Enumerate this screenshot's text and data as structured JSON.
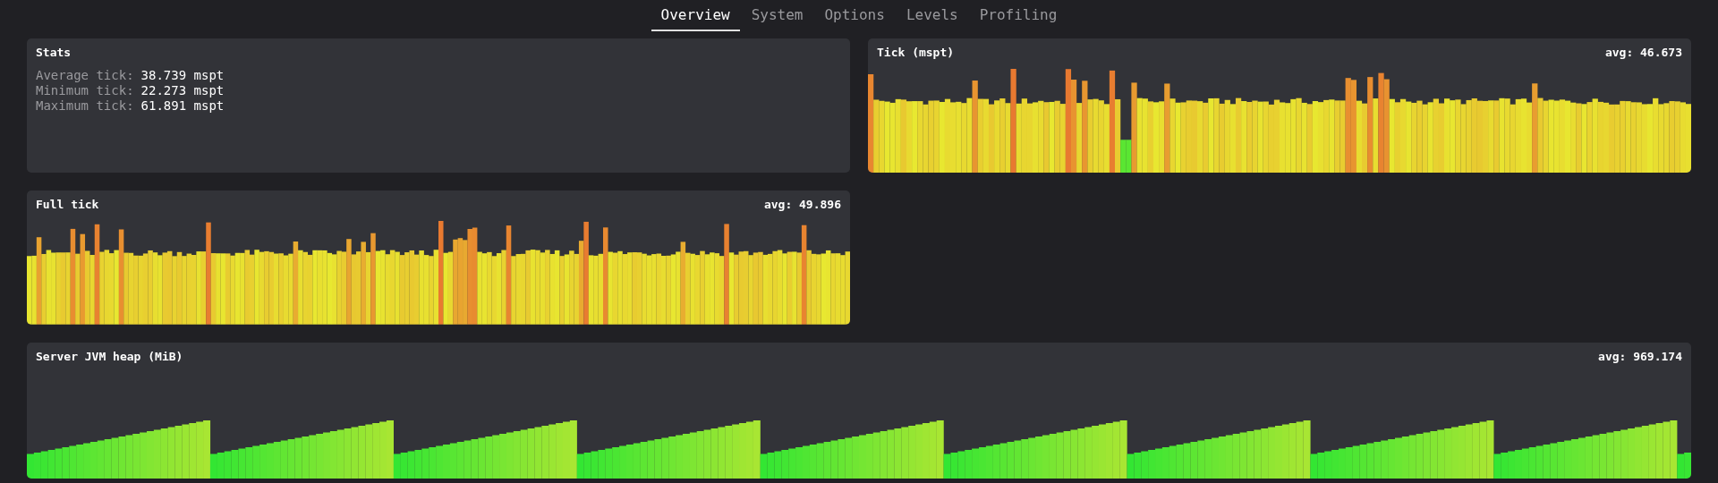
{
  "tabs": [
    {
      "label": "Overview",
      "selected": true
    },
    {
      "label": "System",
      "selected": false
    },
    {
      "label": "Options",
      "selected": false
    },
    {
      "label": "Levels",
      "selected": false
    },
    {
      "label": "Profiling",
      "selected": false
    }
  ],
  "panels": [
    {
      "kind": "stats",
      "title": "Stats",
      "lines": [
        {
          "label": "Average tick:",
          "value": "38.739 mspt"
        },
        {
          "label": "Minimum tick:",
          "value": "22.273 mspt"
        },
        {
          "label": "Maximum tick:",
          "value": "61.891 mspt"
        }
      ]
    },
    {
      "kind": "tick_graph",
      "title": "Tick (mspt)",
      "average": "avg: 46.673"
    },
    {
      "kind": "full_tick_graph",
      "title": "Full tick",
      "average": "avg: 49.896"
    },
    {
      "kind": "heap_graph",
      "title": "Server JVM heap (MiB)",
      "average": "avg: 969.174"
    }
  ]
}
